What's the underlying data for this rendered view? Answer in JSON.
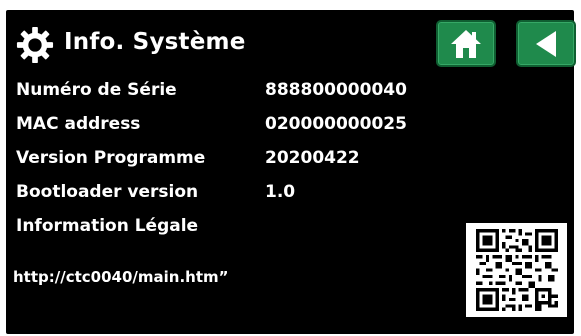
{
  "header": {
    "title": "Info. Système",
    "settings_icon": "gear-icon",
    "home_icon": "home-icon",
    "back_icon": "back-arrow-icon"
  },
  "info_rows": [
    {
      "label": "Numéro de Série",
      "value": "888800000040"
    },
    {
      "label": "MAC address",
      "value": "020000000025"
    },
    {
      "label": "Version Programme",
      "value": "20200422"
    },
    {
      "label": "Bootloader version",
      "value": "1.0"
    }
  ],
  "legal": {
    "label": "Information Légale",
    "url": "http://ctc0040/main.htm”"
  },
  "colors": {
    "background": "#000000",
    "button_green": "#1f8a4c",
    "text": "#ffffff"
  }
}
